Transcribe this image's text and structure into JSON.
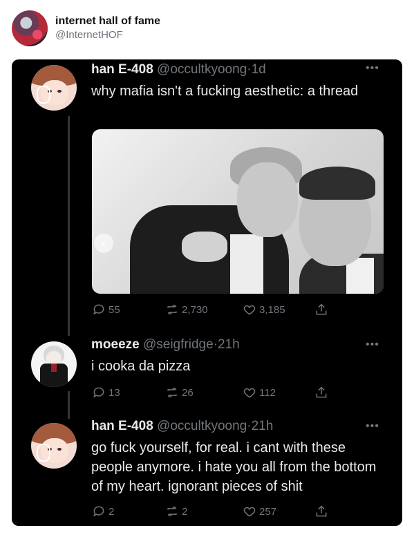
{
  "header": {
    "name": "internet hall of fame",
    "handle": "@InternetHOF"
  },
  "tweets": [
    {
      "name": "han E-408",
      "handle": "@occultkyoong",
      "time": "1d",
      "text": "why mafia isn't a fucking aesthetic: a thread",
      "replies": "55",
      "retweets": "2,730",
      "likes": "3,185",
      "avatar_icon": "avatar-han"
    },
    {
      "name": "moeeze",
      "handle": "@seigfridge",
      "time": "21h",
      "text": "i cooka da pizza",
      "replies": "13",
      "retweets": "26",
      "likes": "112",
      "avatar_icon": "avatar-moeeze"
    },
    {
      "name": "han E-408",
      "handle": "@occultkyoong",
      "time": "21h",
      "text": "go fuck yourself, for real. i cant with these people anymore. i hate you all from the bottom of my heart. ignorant pieces of shit",
      "replies": "2",
      "retweets": "2",
      "likes": "257",
      "avatar_icon": "avatar-han"
    }
  ],
  "icons": {
    "reply": "reply-icon",
    "retweet": "retweet-icon",
    "like": "heart-icon",
    "share": "share-icon",
    "more": "more-icon",
    "carousel": "chevron-left-icon"
  },
  "glyphs": {
    "more": "•••",
    "dot": "·",
    "prev": "‹"
  },
  "colors": {
    "panel_bg": "#000000",
    "text": "#e7e9ea",
    "muted": "#71767b",
    "thread_line": "#333639"
  }
}
